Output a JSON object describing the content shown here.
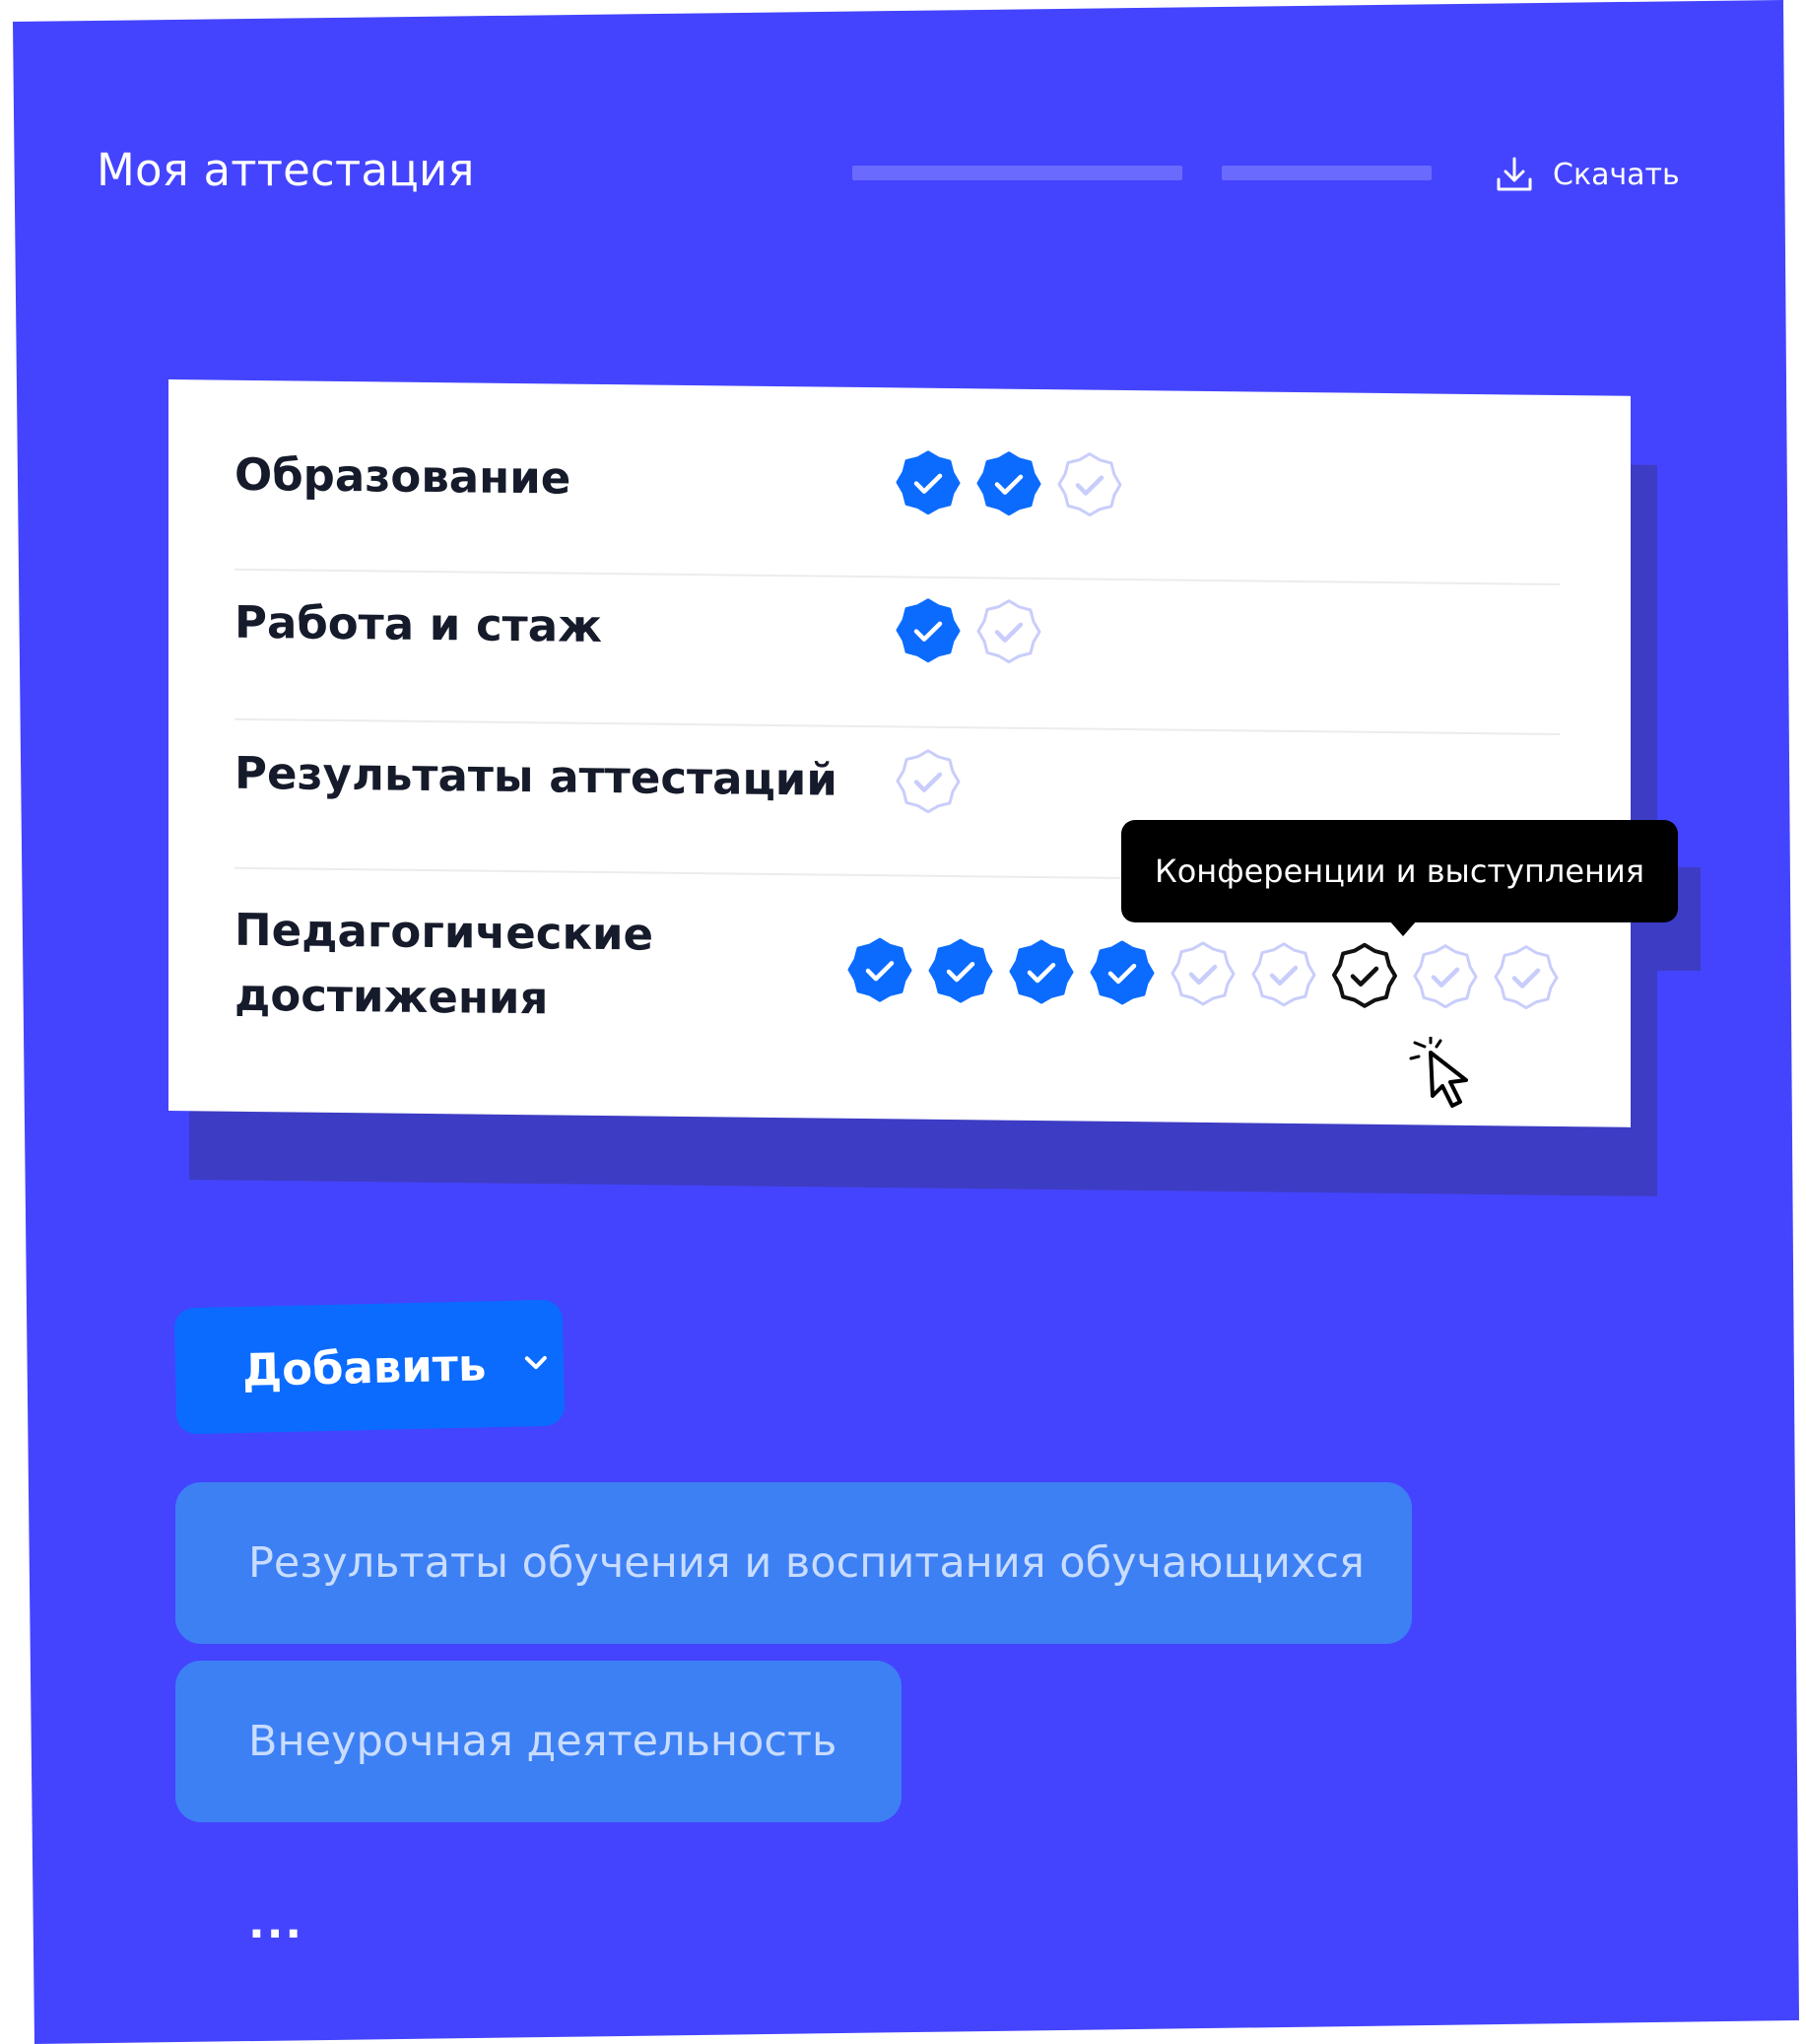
{
  "header": {
    "title": "Моя аттестация",
    "download_label": "Скачать"
  },
  "categories": [
    {
      "label": "Образование",
      "filled": 2,
      "total": 3
    },
    {
      "label": "Работа и стаж",
      "filled": 1,
      "total": 2
    },
    {
      "label": "Результаты аттестаций",
      "filled": 0,
      "total": 1
    },
    {
      "label": "Педагогические\nдостижения",
      "filled": 4,
      "total": 9,
      "hovered_index": 6
    }
  ],
  "tooltip": {
    "text": "Конференции и выступления"
  },
  "add_menu": {
    "button_label": "Добавить",
    "options": [
      "Результаты обучения и воспитания обучающихся",
      "Внеурочная деятельность"
    ],
    "more": "..."
  },
  "colors": {
    "background": "#4444fe",
    "badge_filled": "#0b6bff",
    "badge_empty_outline": "#c9cdfb",
    "badge_hover_outline": "#111111",
    "option_bg": "#3d80f4"
  }
}
